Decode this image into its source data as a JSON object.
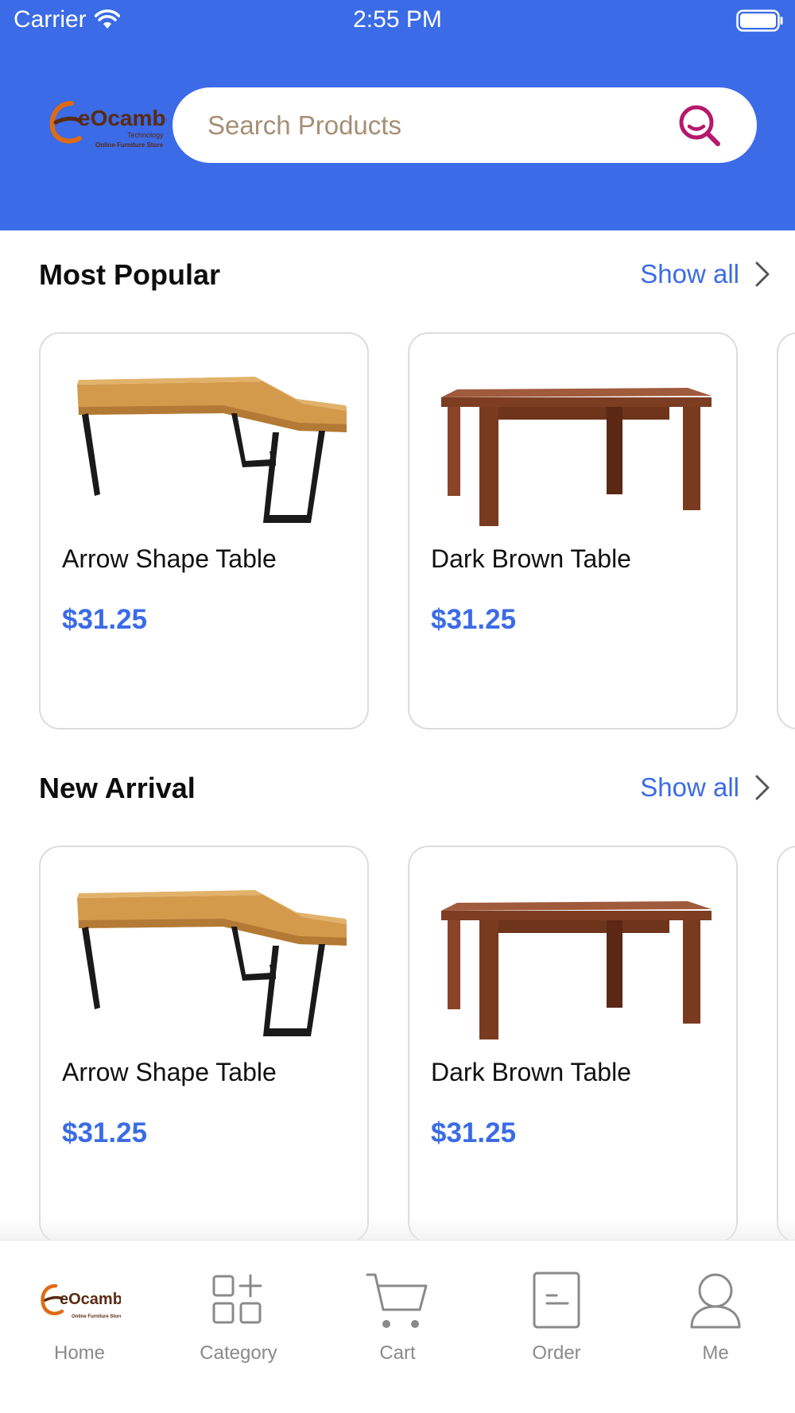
{
  "status_bar": {
    "carrier": "Carrier",
    "time": "2:55 PM"
  },
  "header": {
    "logo_text": "eOcambo",
    "logo_tagline": "Technology",
    "logo_subtitle": "Online Furniture Store",
    "search_placeholder": "Search Products"
  },
  "sections": [
    {
      "title": "Most Popular",
      "show_all": "Show all",
      "products": [
        {
          "name": "Arrow Shape Table",
          "price": "$31.25",
          "image": "l-shaped-desk"
        },
        {
          "name": "Dark Brown Table",
          "price": "$31.25",
          "image": "brown-table"
        }
      ]
    },
    {
      "title": "New Arrival",
      "show_all": "Show all",
      "products": [
        {
          "name": "Arrow Shape Table",
          "price": "$31.25",
          "image": "l-shaped-desk"
        },
        {
          "name": "Dark Brown Table",
          "price": "$31.25",
          "image": "brown-table"
        }
      ]
    }
  ],
  "tab_bar": {
    "items": [
      {
        "label": "Home",
        "icon": "eocambo-logo-icon"
      },
      {
        "label": "Category",
        "icon": "category-grid-icon"
      },
      {
        "label": "Cart",
        "icon": "cart-icon"
      },
      {
        "label": "Order",
        "icon": "order-document-icon"
      },
      {
        "label": "Me",
        "icon": "user-icon"
      }
    ]
  },
  "colors": {
    "brand_blue": "#3b6be6",
    "search_accent": "#b5186c",
    "logo_orange": "#e06a12",
    "logo_brown": "#5a2a12"
  }
}
